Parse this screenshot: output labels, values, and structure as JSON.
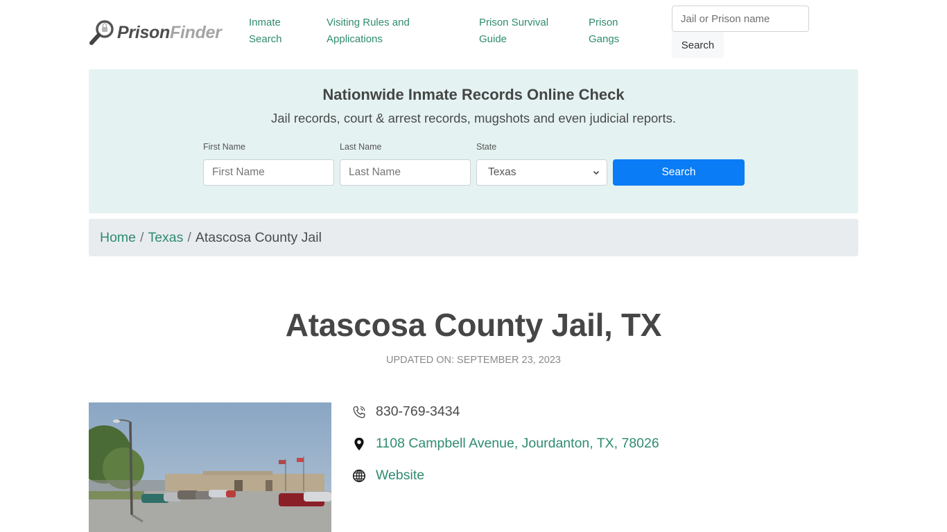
{
  "header": {
    "logo": {
      "part1": "Prison",
      "part2": "Finder"
    },
    "nav": [
      {
        "line1": "Inmate",
        "line2": "Search"
      },
      {
        "line1": "Visiting Rules and",
        "line2": "Applications"
      },
      {
        "line1": "Prison Survival",
        "line2": "Guide"
      },
      {
        "line1": "Prison",
        "line2": "Gangs"
      }
    ],
    "search": {
      "placeholder": "Jail or Prison name",
      "value": "",
      "button_label": "Search"
    }
  },
  "hero": {
    "title": "Nationwide Inmate Records Online Check",
    "subtitle": "Jail records, court & arrest records, mugshots and even judicial reports.",
    "fields": {
      "first_name": {
        "label": "First Name",
        "placeholder": "First Name",
        "value": ""
      },
      "last_name": {
        "label": "Last Name",
        "placeholder": "Last Name",
        "value": ""
      },
      "state": {
        "label": "State",
        "selected": "Texas"
      }
    },
    "button_label": "Search",
    "colors": {
      "panel_bg": "#e4f3f1",
      "button_bg": "#0a7cf5"
    }
  },
  "breadcrumb": {
    "items": [
      {
        "label": "Home",
        "link": true
      },
      {
        "label": "Texas",
        "link": true
      },
      {
        "label": "Atascosa County Jail",
        "link": false
      }
    ],
    "separator": "/"
  },
  "facility": {
    "title": "Atascosa County Jail, TX",
    "updated": "UPDATED ON: SEPTEMBER 23, 2023",
    "photo_alt": "Street view of Atascosa County Jail building with parked cars and flags",
    "contact": {
      "phone": {
        "icon": "phone-icon",
        "value": "830-769-3434"
      },
      "address": {
        "icon": "map-pin-icon",
        "value": "1108 Campbell Avenue, Jourdanton, TX, 78026"
      },
      "website": {
        "icon": "globe-icon",
        "label": "Website"
      }
    }
  },
  "colors": {
    "link": "#2e8b6f",
    "text": "#4a4a4a",
    "breadcrumb_bg": "#e9ecef"
  }
}
